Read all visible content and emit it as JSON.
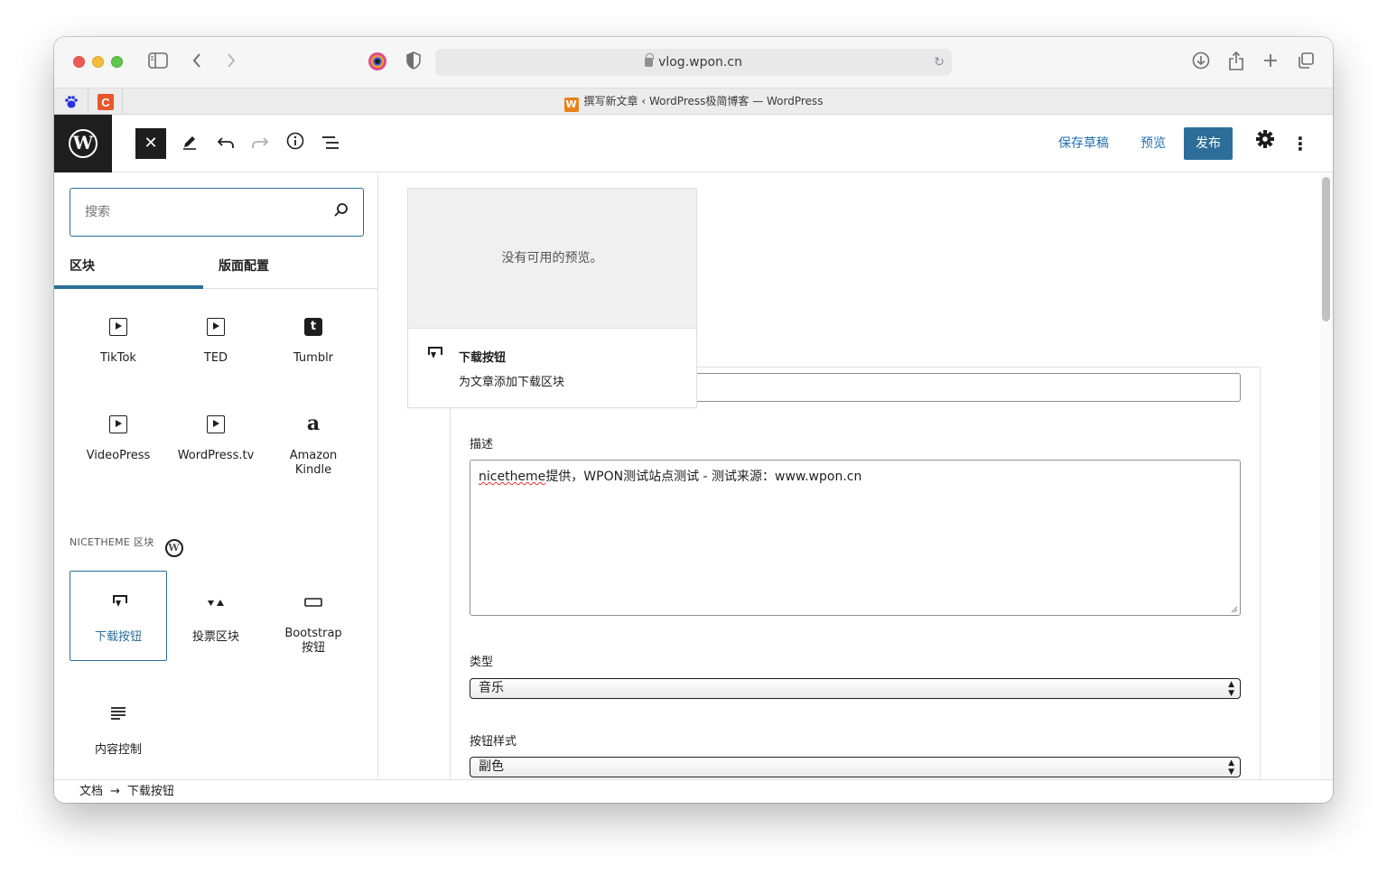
{
  "browser": {
    "url": "vlog.wpon.cn",
    "tab_title": "撰写新文章 ‹ WordPress极简博客 — WordPress",
    "tab_favicon_letter": "W",
    "pinned_tabs": [
      "baidu-icon",
      "c-icon"
    ]
  },
  "header": {
    "save_draft": "保存草稿",
    "preview": "预览",
    "publish": "发布"
  },
  "inserter": {
    "search_placeholder": "搜索",
    "tabs": [
      "区块",
      "版面配置"
    ],
    "embed_blocks": [
      {
        "label": "TikTok",
        "icon": "embed-video-icon"
      },
      {
        "label": "TED",
        "icon": "embed-video-icon"
      },
      {
        "label": "Tumblr",
        "icon": "tumblr-icon"
      },
      {
        "label": "VideoPress",
        "icon": "embed-video-icon"
      },
      {
        "label": "WordPress.tv",
        "icon": "embed-video-icon"
      },
      {
        "label": "Amazon Kindle",
        "icon": "amazon-icon"
      }
    ],
    "section_title": "NICETHEME 区块",
    "theme_blocks": [
      {
        "label": "下载按钮",
        "icon": "download-icon",
        "selected": true
      },
      {
        "label": "投票区块",
        "icon": "vote-icon"
      },
      {
        "label": "Bootstrap 按钮",
        "icon": "button-icon"
      },
      {
        "label": "内容控制",
        "icon": "content-control-icon"
      }
    ]
  },
  "preview_popover": {
    "empty_text": "没有可用的预览。",
    "block_title": "下载按钮",
    "block_description": "为文章添加下载区块"
  },
  "form": {
    "description_label": "描述",
    "description_value_spell": "nicetheme",
    "description_value_rest": "提供，WPON测试站点测试 - 测试来源：www.wpon.cn",
    "type_label": "类型",
    "type_value": "音乐",
    "style_label": "按钮样式",
    "style_value": "副色"
  },
  "footer": {
    "breadcrumb_root": "文档",
    "breadcrumb_current": "下载按钮"
  },
  "colors": {
    "accent": "#2c6e99",
    "link": "#2271b1",
    "dark": "#1e1e1e"
  }
}
